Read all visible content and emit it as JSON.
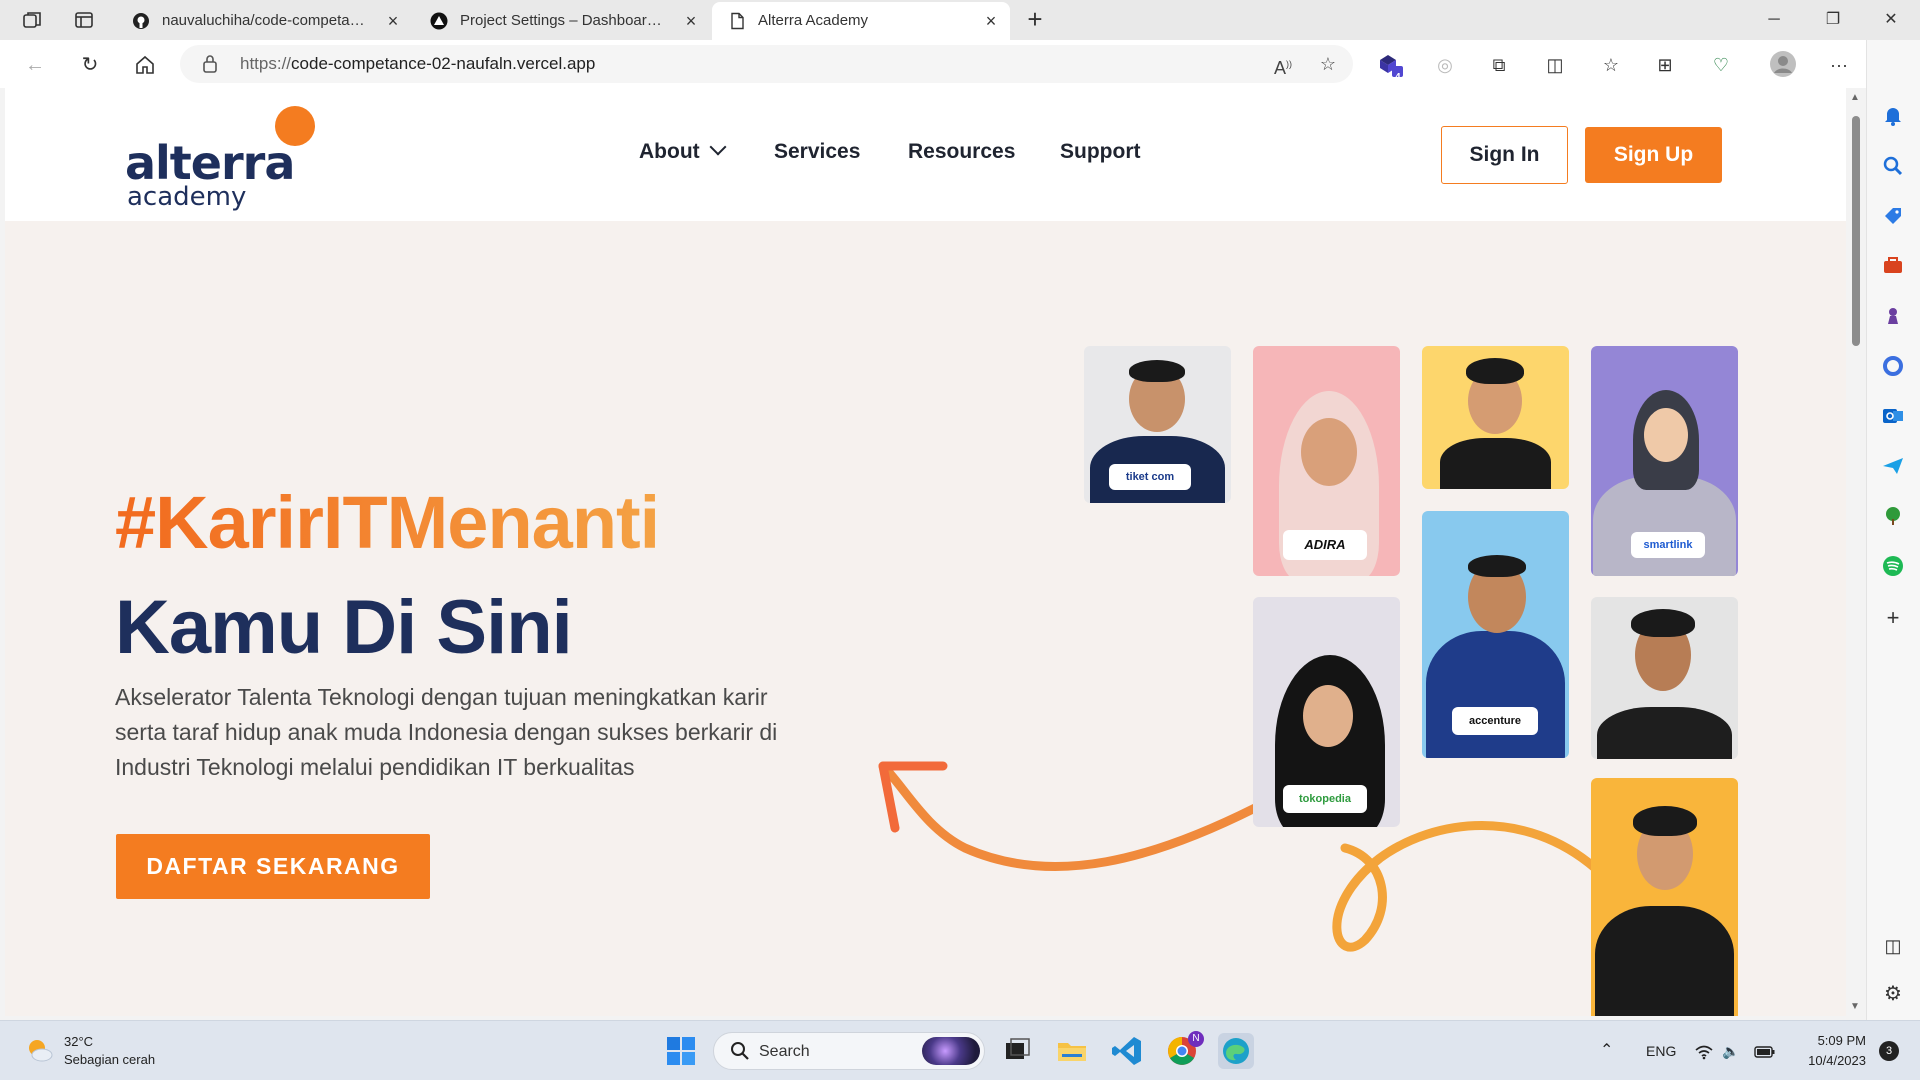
{
  "browser": {
    "tabs": [
      {
        "title": "nauvaluchiha/code-competance-",
        "icon": "github-icon"
      },
      {
        "title": "Project Settings – Dashboard – V",
        "icon": "vercel-icon"
      },
      {
        "title": "Alterra Academy",
        "icon": "page-icon"
      }
    ],
    "url_proto": "https://",
    "url_rest": "code-competance-02-naufaln.vercel.app",
    "extension_badge": "4"
  },
  "site": {
    "logo_word": "alterra",
    "logo_sub": "academy",
    "nav": {
      "about": "About",
      "services": "Services",
      "resources": "Resources",
      "support": "Support"
    },
    "sign_in": "Sign In",
    "sign_up": "Sign Up",
    "hashtag": "#KarirITMenanti",
    "headline": "Kamu Di Sini",
    "description": "Akselerator Talenta Teknologi dengan tujuan meningkatkan karir serta taraf hidup anak muda Indonesia dengan sukses berkarir di Industri Teknologi melalui pendidikan IT berkualitas",
    "cta": "DAFTAR SEKARANG",
    "badges": {
      "tiket": "tiket com",
      "adira": "ADIRA",
      "smartlink": "smartlink",
      "accenture": "accenture",
      "tokopedia": "tokopedia"
    },
    "colors": {
      "brand_orange": "#f47c20",
      "brand_navy": "#1e2f5c",
      "hero_bg": "#f6f1ee"
    }
  },
  "taskbar": {
    "temperature": "32°C",
    "weather": "Sebagian cerah",
    "search": "Search",
    "language": "ENG",
    "time": "5:09 PM",
    "date": "10/4/2023",
    "notifications": "3",
    "chrome_badge": "N"
  }
}
